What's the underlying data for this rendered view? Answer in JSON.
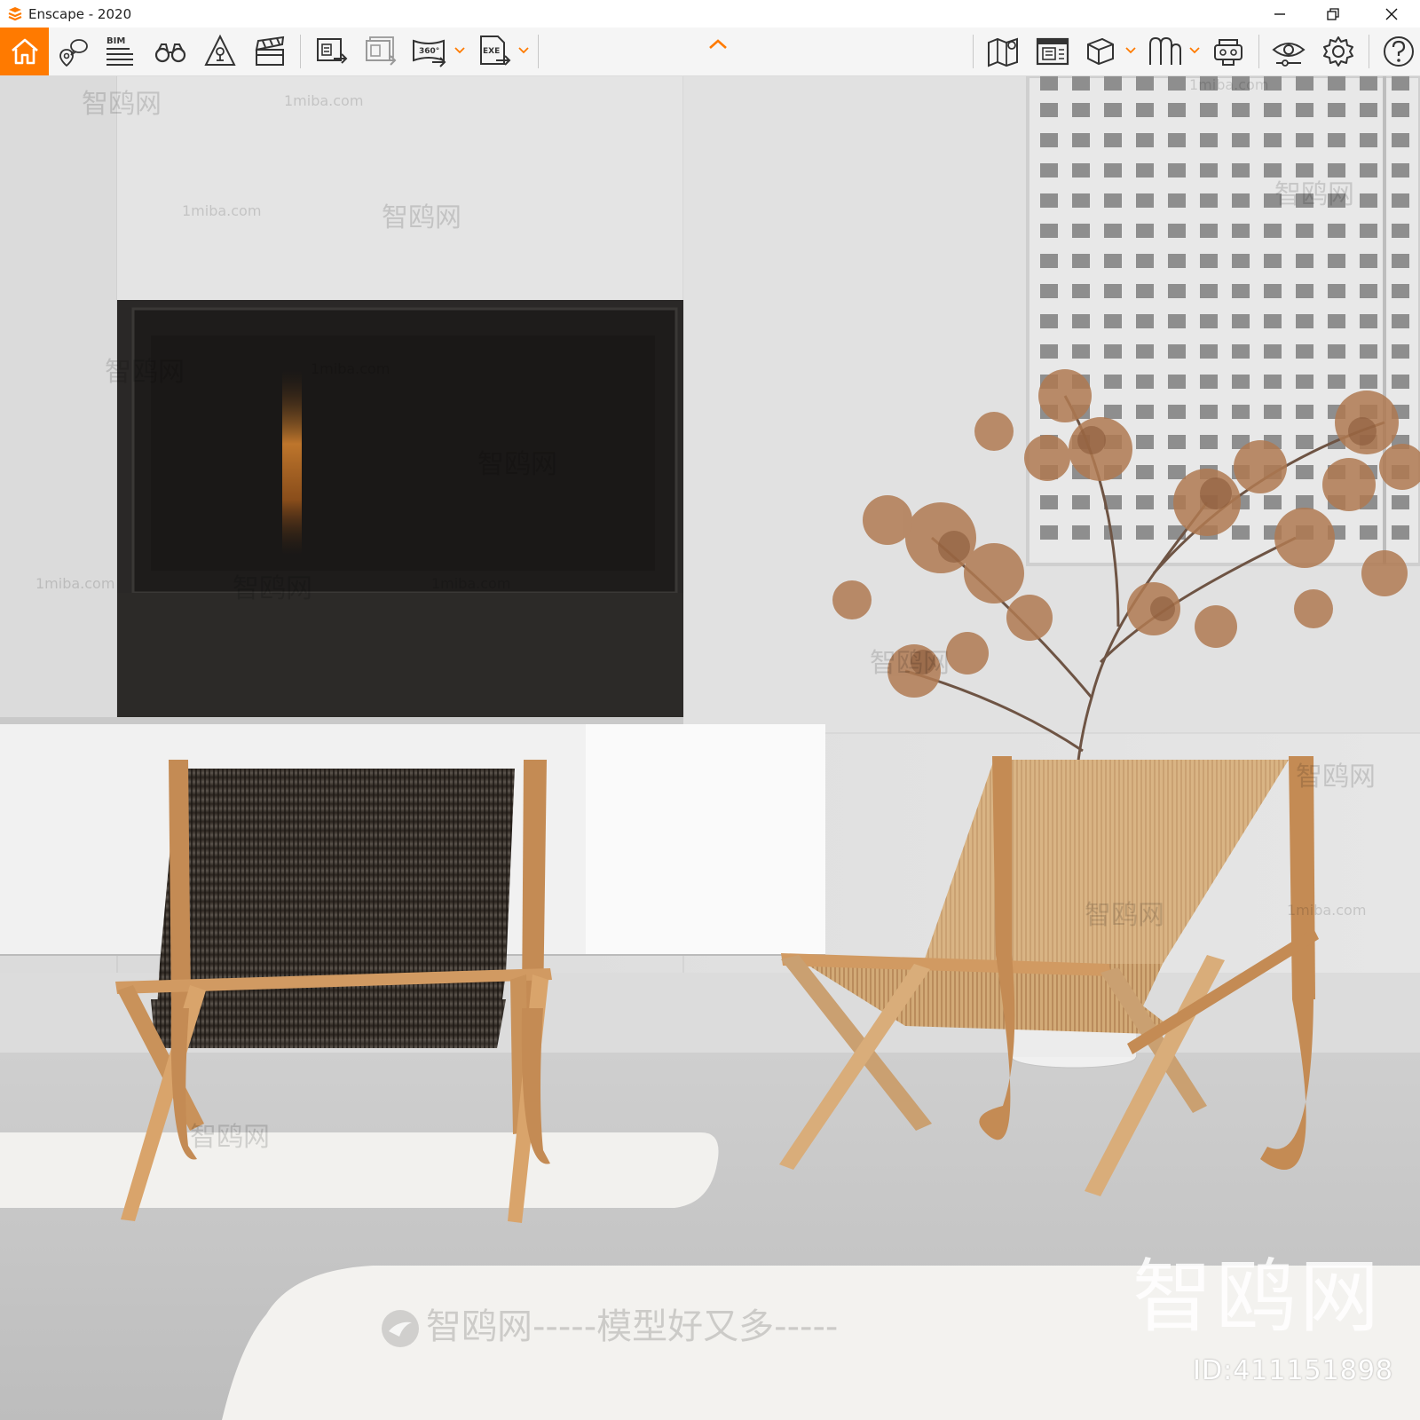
{
  "window": {
    "title": "Enscape - 2020"
  },
  "toolbar": {
    "bim_label": "BIM",
    "panorama_label": "360°",
    "exe_label": "EXE",
    "accent": "#ff7a00"
  },
  "watermarks": {
    "site": "1miba.com",
    "cn": "智鸥网",
    "slogan": "智鸥网-----模型好又多-----",
    "big": "智鸥网",
    "id": "ID:411151898"
  }
}
